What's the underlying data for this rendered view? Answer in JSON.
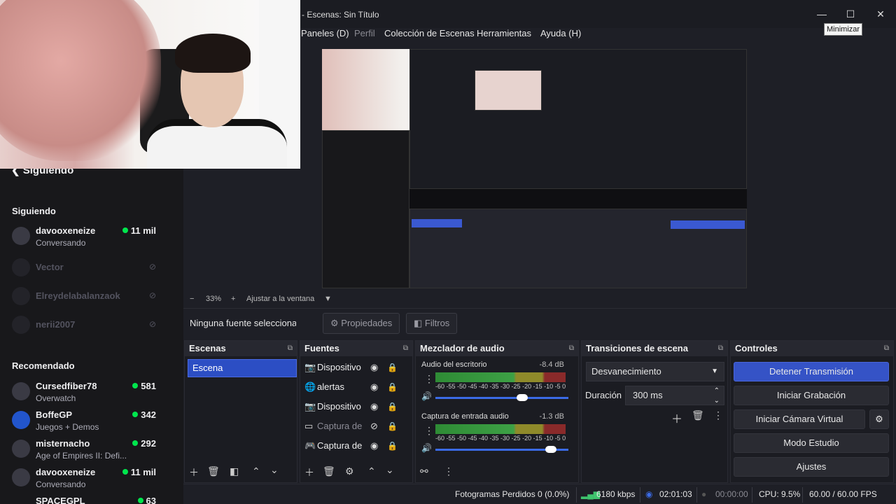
{
  "twitch": {
    "header": "Siguiendo",
    "following_title": "Siguiendo",
    "following": [
      {
        "name": "davooxeneize",
        "game": "Conversando",
        "viewers": "11 mil",
        "live": true
      },
      {
        "name": "Vector",
        "live": false
      },
      {
        "name": "Elreydelabalanzaok",
        "live": false
      },
      {
        "name": "nerii2007",
        "live": false
      }
    ],
    "recommended_title": "Recomendado",
    "recommended": [
      {
        "name": "Cursedfiber78",
        "game": "Overwatch",
        "viewers": "581"
      },
      {
        "name": "BoffeGP",
        "game": "Juegos + Demos",
        "viewers": "342"
      },
      {
        "name": "misternacho",
        "game": "Age of Empires II: Defi...",
        "viewers": "292"
      },
      {
        "name": "davooxeneize",
        "game": "Conversando",
        "viewers": "11 mil"
      },
      {
        "name": "SPACEGPL",
        "viewers": "63"
      }
    ]
  },
  "obs": {
    "window_title": "- Escenas: Sin Título",
    "tooltip": "Minimizar",
    "menus": [
      "Paneles (D)",
      "Perfil",
      "Colección de Escenas",
      "Herramientas",
      "Ayuda (H)"
    ],
    "zoom": {
      "minus": "−",
      "value": "33%",
      "plus": "+",
      "fit": "Ajustar a la ventana"
    },
    "source_bar": {
      "no_source": "Ninguna fuente seleccionad",
      "properties": "Propiedades",
      "filters": "Filtros"
    },
    "docks": {
      "scenes": {
        "title": "Escenas",
        "items": [
          "Escena"
        ]
      },
      "sources": {
        "title": "Fuentes",
        "items": [
          {
            "icon": "camera-icon",
            "label": "Dispositivo",
            "visible": true
          },
          {
            "icon": "browser-icon",
            "label": "alertas",
            "visible": true
          },
          {
            "icon": "camera-icon",
            "label": "Dispositivo",
            "visible": true
          },
          {
            "icon": "window-capture-icon",
            "label": "Captura de",
            "visible": false
          },
          {
            "icon": "gamepad-icon",
            "label": "Captura de",
            "visible": true
          }
        ]
      },
      "mixer": {
        "title": "Mezclador de audio",
        "channels": [
          {
            "name": "Audio del escritorio",
            "db": "-8.4 dB",
            "level": 0.72,
            "volume": 0.66
          },
          {
            "name": "Captura de entrada audio",
            "db": "-1.3 dB",
            "level": 0.95,
            "volume": 0.9
          }
        ],
        "scale": "-60 -55 -50 -45 -40 -35 -30 -25 -20 -15 -10 -5 0"
      },
      "transitions": {
        "title": "Transiciones de escena",
        "type": "Desvanecimiento",
        "duration_label": "Duración",
        "duration": "300 ms"
      },
      "controls": {
        "title": "Controles",
        "buttons": [
          "Detener Transmisión",
          "Iniciar Grabación",
          "Iniciar Cámara Virtual",
          "Modo Estudio",
          "Ajustes"
        ]
      }
    },
    "status": {
      "dropped": "Fotogramas Perdidos 0 (0.0%)",
      "bitrate": "6180 kbps",
      "live_time": "02:01:03",
      "rec_time": "00:00:00",
      "cpu": "CPU: 9.5%",
      "fps": "60.00 / 60.00 FPS"
    },
    "colors": {
      "accent": "#3553c6",
      "panel": "#1b1c22",
      "live_green": "#00e64d"
    }
  }
}
